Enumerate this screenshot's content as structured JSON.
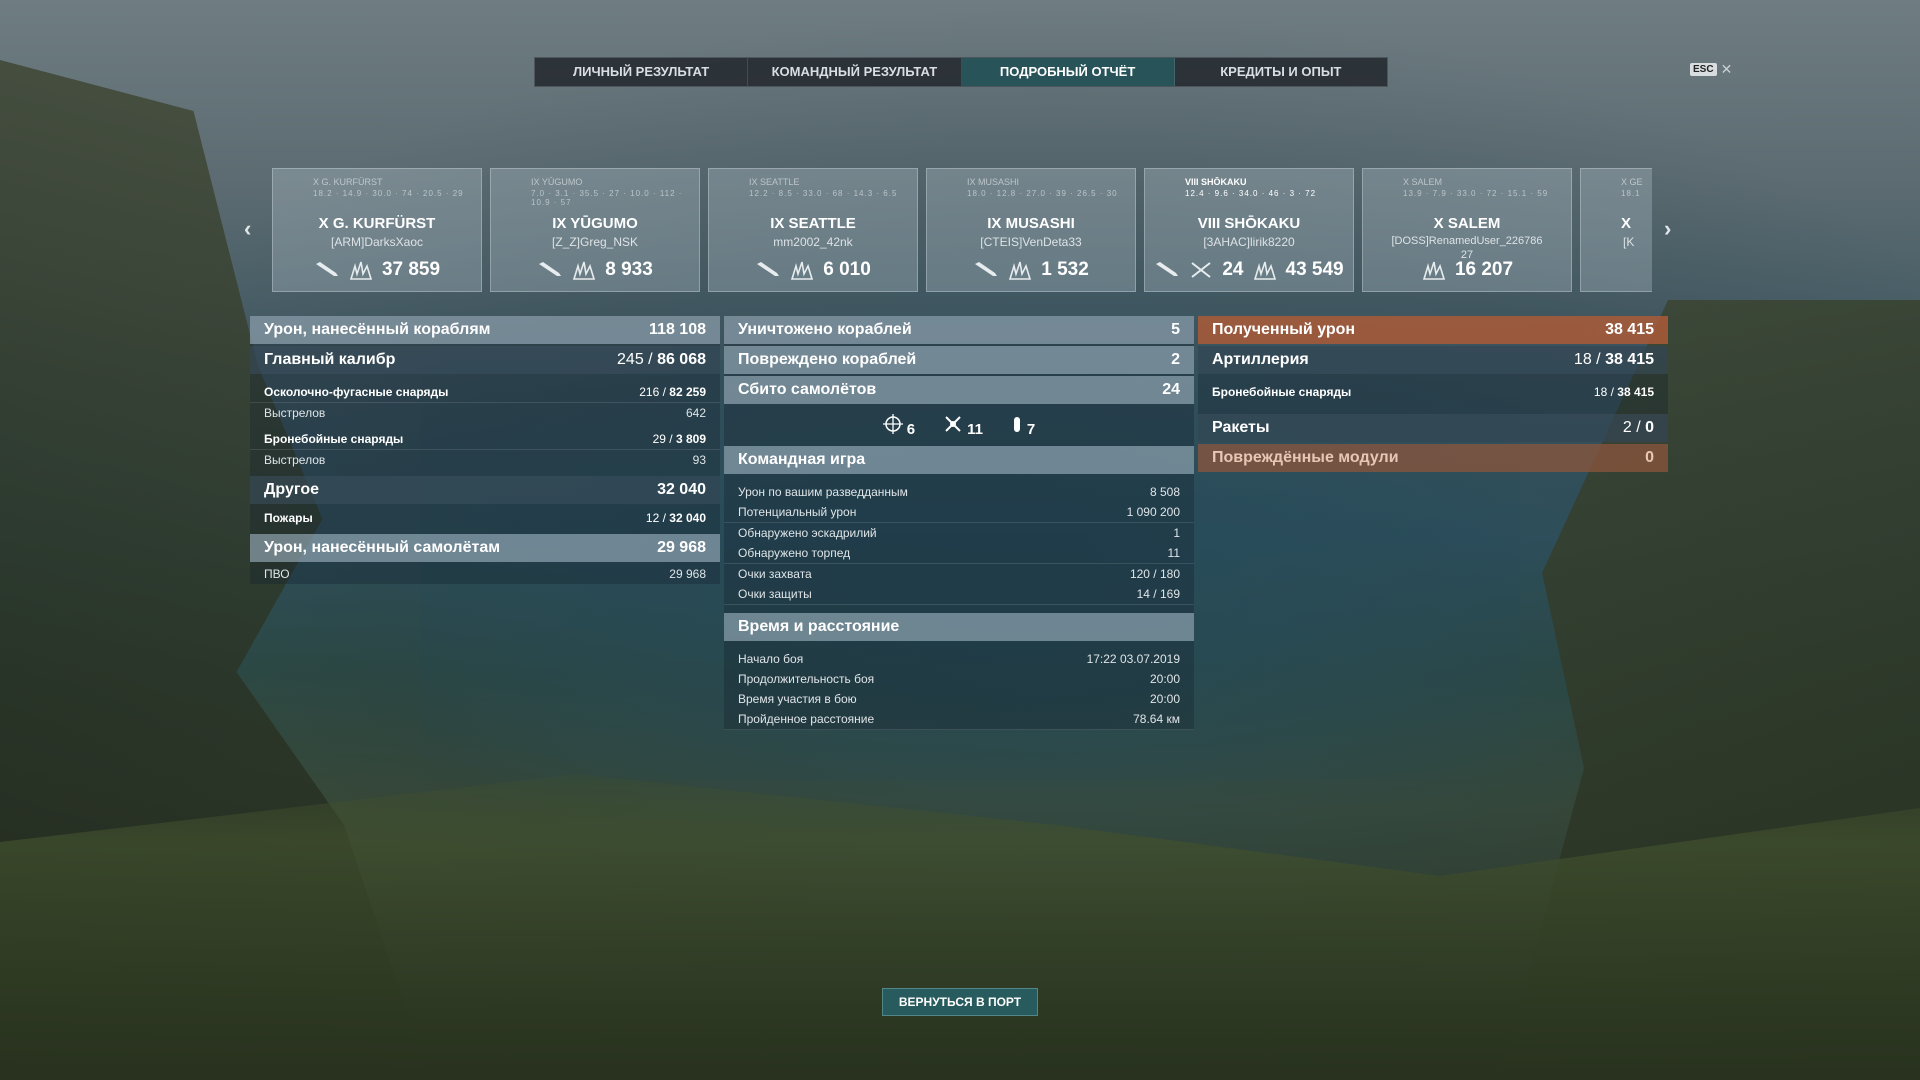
{
  "tabs": [
    "ЛИЧНЫЙ РЕЗУЛЬТАТ",
    "КОМАНДНЫЙ РЕЗУЛЬТАТ",
    "ПОДРОБНЫЙ ОТЧЁТ",
    "КРЕДИТЫ И ОПЫТ"
  ],
  "active_tab": "ПОДРОБНЫЙ ОТЧЁТ",
  "esc": "ESC",
  "ships": [
    {
      "top": "X G. KURFÜRST",
      "stats": "18.2 · 14.9 · 30.0 · 74 · 20.5 · 29",
      "name": "X G. KURFÜRST",
      "player": "[ARM]DarksXaoc",
      "value": "37 859"
    },
    {
      "top": "IX YŪGUMO",
      "stats": "7.0 · 3.1 · 35.5 · 27 · 10.0 · 112 · 10.9 · 57",
      "name": "IX YŪGUMO",
      "player": "[Z_Z]Greg_NSK",
      "value": "8 933"
    },
    {
      "top": "IX SEATTLE",
      "stats": "12.2 · 8.5 · 33.0 · 68 · 14.3 · 6.5",
      "name": "IX SEATTLE",
      "player": "mm2002_42nk",
      "value": "6 010"
    },
    {
      "top": "IX MUSASHI",
      "stats": "18.0 · 12.8 · 27.0 · 39 · 26.5 · 30",
      "name": "IX MUSASHI",
      "player": "[CTEIS]VenDeta33",
      "value": "1 532"
    },
    {
      "top": "VIII SHŌKAKU",
      "stats": "12.4 · 9.6 · 34.0 · 46 · 3 · 72",
      "name": "VIII SHŌKAKU",
      "player": "[3AHAC]lirik8220",
      "value": "43 549",
      "planes": "24"
    },
    {
      "top": "X SALEM",
      "stats": "13.9 · 7.9 · 33.0 · 72 · 15.1 · 59",
      "name": "X SALEM",
      "player": "[DOSS]RenamedUser_226786",
      "extra": "27",
      "value": "16 207"
    },
    {
      "top": "X GE",
      "stats": "18.1",
      "name": "X",
      "player": "[K"
    }
  ],
  "left": {
    "damage_ships": {
      "label": "Урон, нанесённый кораблям",
      "value": "118 108"
    },
    "main_battery": {
      "label": "Главный калибр",
      "hits": "245",
      "value": "86 068"
    },
    "he": {
      "label": "Осколочно-фугасные снаряды",
      "hits": "216",
      "value": "82 259"
    },
    "he_shots": {
      "label": "Выстрелов",
      "value": "642"
    },
    "ap": {
      "label": "Бронебойные снаряды",
      "hits": "29",
      "value": "3 809"
    },
    "ap_shots": {
      "label": "Выстрелов",
      "value": "93"
    },
    "other": {
      "label": "Другое",
      "value": "32 040"
    },
    "fires": {
      "label": "Пожары",
      "hits": "12",
      "value": "32 040"
    },
    "damage_planes": {
      "label": "Урон, нанесённый самолётам",
      "value": "29 968"
    },
    "aa": {
      "label": "ПВО",
      "value": "29 968"
    }
  },
  "mid": {
    "destroyed": {
      "label": "Уничтожено кораблей",
      "value": "5"
    },
    "damaged": {
      "label": "Повреждено кораблей",
      "value": "2"
    },
    "planes_down": {
      "label": "Сбито самолётов",
      "value": "24"
    },
    "icon_counts": {
      "spotted": "6",
      "planes": "11",
      "torps": "7"
    },
    "team_title": "Командная игра",
    "team": [
      {
        "label": "Урон по вашим разведданным",
        "value": "8 508"
      },
      {
        "label": "Потенциальный урон",
        "value": "1 090 200"
      },
      {
        "label": "Обнаружено эскадрилий",
        "value": "1"
      },
      {
        "label": "Обнаружено торпед",
        "value": "11"
      },
      {
        "label": "Очки захвата",
        "value": "120 / 180"
      },
      {
        "label": "Очки защиты",
        "value": "14 / 169"
      }
    ],
    "time_title": "Время и расстояние",
    "time": [
      {
        "label": "Начало боя",
        "value": "17:22  03.07.2019"
      },
      {
        "label": "Продолжительность боя",
        "value": "20:00"
      },
      {
        "label": "Время участия в бою",
        "value": "20:00"
      },
      {
        "label": "Пройденное расстояние",
        "value": "78.64 км"
      }
    ]
  },
  "right": {
    "received": {
      "label": "Полученный урон",
      "value": "38 415"
    },
    "artillery": {
      "label": "Артиллерия",
      "hits": "18",
      "value": "38 415"
    },
    "ap": {
      "label": "Бронебойные снаряды",
      "hits": "18",
      "value": "38 415"
    },
    "rockets": {
      "label": "Ракеты",
      "hits": "2",
      "value": "0"
    },
    "modules": {
      "label": "Повреждённые модули",
      "value": "0"
    }
  },
  "return_button": "ВЕРНУТЬСЯ В ПОРТ"
}
